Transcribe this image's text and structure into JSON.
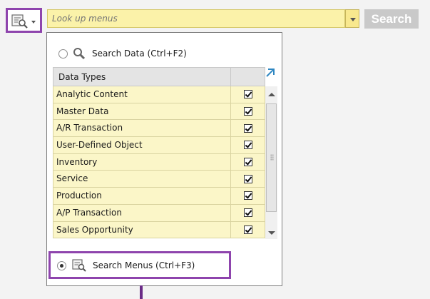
{
  "search": {
    "placeholder": "Look up menus",
    "button_label": "Search"
  },
  "panel": {
    "search_data_label": "Search Data (Ctrl+F2)",
    "search_data_selected": false,
    "table_header": "Data Types",
    "data_types": [
      {
        "label": "Analytic Content",
        "checked": true
      },
      {
        "label": "Master Data",
        "checked": true
      },
      {
        "label": "A/R Transaction",
        "checked": true
      },
      {
        "label": "User-Defined Object",
        "checked": true
      },
      {
        "label": "Inventory",
        "checked": true
      },
      {
        "label": "Service",
        "checked": true
      },
      {
        "label": "Production",
        "checked": true
      },
      {
        "label": "A/P Transaction",
        "checked": true
      },
      {
        "label": "Sales Opportunity",
        "checked": true
      }
    ],
    "search_menus_label": "Search Menus (Ctrl+F3)",
    "search_menus_selected": true
  },
  "colors": {
    "highlight": "#8e44ad",
    "input_bg": "#fbf2a9",
    "row_bg": "#fbf6c8"
  },
  "icons": [
    "search-menus-icon",
    "search-data-icon",
    "expand-icon",
    "chevron-down-icon",
    "checkbox-checked-icon"
  ]
}
